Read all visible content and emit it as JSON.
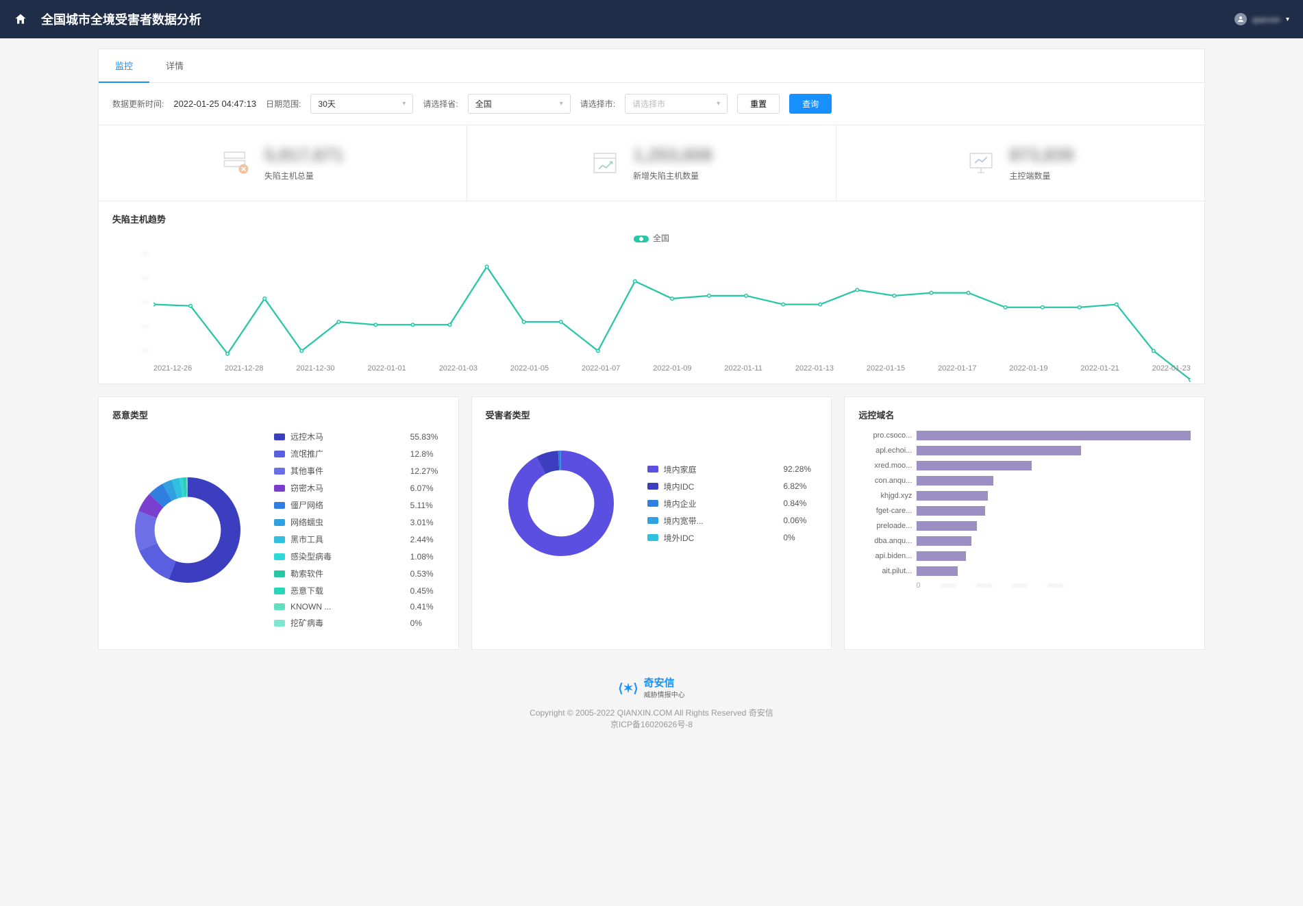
{
  "header": {
    "title": "全国城市全境受害者数据分析",
    "username": "qianxin"
  },
  "tabs": {
    "monitor": "监控",
    "detail": "详情"
  },
  "filter": {
    "update_label": "数据更新时间:",
    "update_value": "2022-01-25 04:47:13",
    "range_label": "日期范围:",
    "range_value": "30天",
    "province_label": "请选择省:",
    "province_value": "全国",
    "city_label": "请选择市:",
    "city_placeholder": "请选择市",
    "reset": "重置",
    "query": "查询"
  },
  "stats": {
    "s1": {
      "label": "失陷主机总量",
      "value": "5,917,671"
    },
    "s2": {
      "label": "新增失陷主机数量",
      "value": "1,253,608"
    },
    "s3": {
      "label": "主控端数量",
      "value": "873,839"
    }
  },
  "trend": {
    "title": "失陷主机趋势",
    "legend": "全国"
  },
  "malware": {
    "title": "恶意类型"
  },
  "victim": {
    "title": "受害者类型"
  },
  "domain": {
    "title": "远控域名"
  },
  "footer": {
    "brand": "奇安信",
    "brand_sub": "威胁情报中心",
    "copyright": "Copyright © 2005-2022 QIANXIN.COM All Rights Reserved 奇安信",
    "icp": "京ICP备16020626号-8"
  },
  "chart_data": {
    "trend": {
      "type": "line",
      "x": [
        "2021-12-26",
        "2021-12-28",
        "2021-12-30",
        "2022-01-01",
        "2022-01-03",
        "2022-01-05",
        "2022-01-07",
        "2022-01-09",
        "2022-01-11",
        "2022-01-13",
        "2022-01-15",
        "2022-01-17",
        "2022-01-19",
        "2022-01-21",
        "2022-01-23"
      ],
      "series": [
        {
          "name": "全国",
          "values": [
            62,
            61,
            28,
            66,
            30,
            50,
            48,
            48,
            48,
            88,
            50,
            50,
            30,
            78,
            66,
            68,
            68,
            62,
            62,
            72,
            68,
            70,
            70,
            60,
            60,
            60,
            62,
            30,
            10
          ]
        }
      ],
      "ylim": [
        0,
        100
      ]
    },
    "malware": {
      "type": "pie",
      "colors": [
        "#3b3fbf",
        "#5a5fe0",
        "#6d6fe6",
        "#7a3fcf",
        "#2f7fe0",
        "#2fa0e0",
        "#2fc0e0",
        "#2fd8d8",
        "#26c6a6",
        "#26d6b6",
        "#60e0c0",
        "#80e8d0"
      ],
      "data": [
        {
          "name": "远控木马",
          "pct": 55.83
        },
        {
          "name": "流氓推广",
          "pct": 12.8
        },
        {
          "name": "其他事件",
          "pct": 12.27
        },
        {
          "name": "窃密木马",
          "pct": 6.07
        },
        {
          "name": "僵尸网络",
          "pct": 5.11
        },
        {
          "name": "网络蠕虫",
          "pct": 3.01
        },
        {
          "name": "黑市工具",
          "pct": 2.44
        },
        {
          "name": "感染型病毒",
          "pct": 1.08
        },
        {
          "name": "勒索软件",
          "pct": 0.53
        },
        {
          "name": "恶意下载",
          "pct": 0.45
        },
        {
          "name": "KNOWN ...",
          "pct": 0.41
        },
        {
          "name": "挖矿病毒",
          "pct": 0
        }
      ]
    },
    "victim": {
      "type": "pie",
      "colors": [
        "#5a4fe0",
        "#3b3fbf",
        "#2f7fe0",
        "#2fa0e0",
        "#2fc0e0"
      ],
      "data": [
        {
          "name": "境内家庭",
          "pct": 92.28
        },
        {
          "name": "境内IDC",
          "pct": 6.82
        },
        {
          "name": "境内企业",
          "pct": 0.84
        },
        {
          "name": "境内宽带...",
          "pct": 0.06
        },
        {
          "name": "境外IDC",
          "pct": 0
        }
      ]
    },
    "domain": {
      "type": "bar",
      "orientation": "horizontal",
      "categories": [
        "pro.csoco...",
        "apl.echoi...",
        "xred.moo...",
        "con.anqu...",
        "khjgd.xyz",
        "fget-care...",
        "preloade...",
        "dba.anqu...",
        "api.biden...",
        "ait.pilut..."
      ],
      "values": [
        100,
        60,
        42,
        28,
        26,
        25,
        22,
        20,
        18,
        15
      ]
    }
  }
}
